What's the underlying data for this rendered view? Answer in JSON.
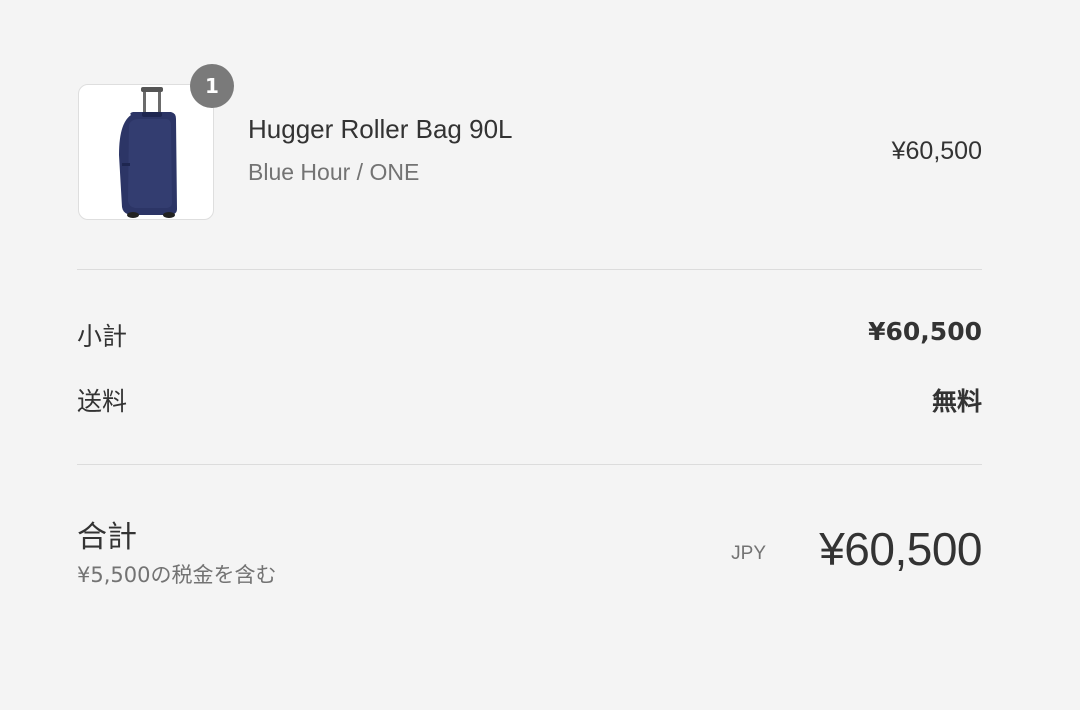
{
  "line_item": {
    "quantity": "1",
    "name": "Hugger Roller Bag 90L",
    "variant": "Blue Hour / ONE",
    "price": "¥60,500",
    "image_icon": "roller-bag-icon",
    "image_color": "#2c3566"
  },
  "summary": {
    "subtotal_label": "小計",
    "subtotal_value": "¥60,500",
    "shipping_label": "送料",
    "shipping_value": "無料"
  },
  "total": {
    "label": "合計",
    "tax_note": "¥5,500の税金を含む",
    "currency": "JPY",
    "amount": "¥60,500"
  }
}
